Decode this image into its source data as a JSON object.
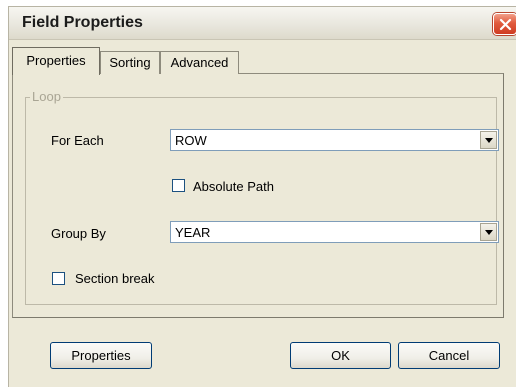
{
  "window": {
    "title": "Field Properties"
  },
  "tabs": [
    {
      "label": "Properties",
      "active": true
    },
    {
      "label": "Sorting",
      "active": false
    },
    {
      "label": "Advanced",
      "active": false
    }
  ],
  "loop_group": {
    "legend": "Loop",
    "for_each": {
      "label": "For Each",
      "value": "ROW"
    },
    "absolute_path": {
      "label": "Absolute Path",
      "checked": false
    },
    "group_by": {
      "label": "Group By",
      "value": "YEAR"
    },
    "section_break": {
      "label": "Section break",
      "checked": false
    }
  },
  "buttons": {
    "properties": "Properties",
    "ok": "OK",
    "cancel": "Cancel"
  },
  "icons": {
    "close": "close-icon",
    "dropdown": "chevron-down-icon"
  },
  "colors": {
    "dialog_background": "#ece9d8",
    "close_button": "#e15b3e",
    "combo_border": "#7f9db9",
    "button_border": "#003c74",
    "disabled_text": "#a9a594"
  }
}
